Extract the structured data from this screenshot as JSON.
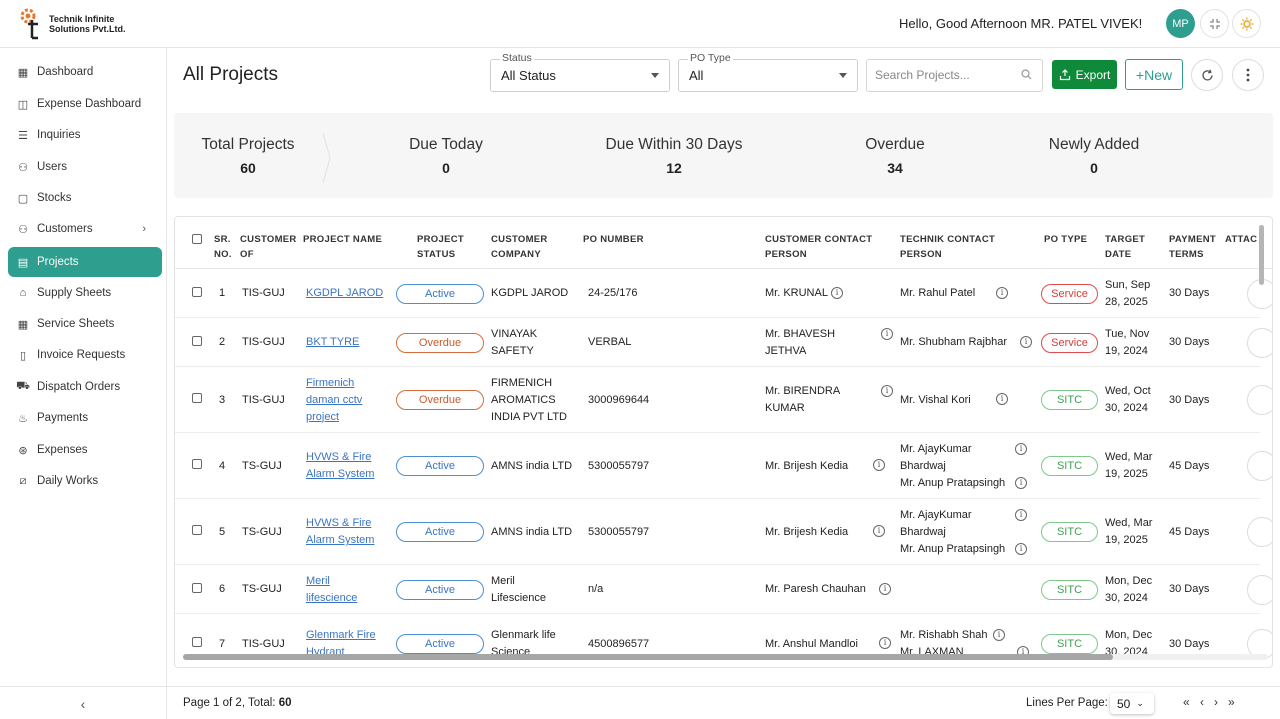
{
  "brand": {
    "logo_line1": "Technik Infinite",
    "logo_line2": "Solutions Pvt.Ltd."
  },
  "header": {
    "greeting": "Hello, Good Afternoon MR. PATEL VIVEK!",
    "avatar_initials": "MP",
    "icons": [
      "fullscreen-exit-icon",
      "theme-sun-icon"
    ]
  },
  "sidebar": {
    "items": [
      {
        "label": "Dashboard",
        "icon": "dashboard-icon"
      },
      {
        "label": "Expense Dashboard",
        "icon": "expense-dashboard-icon"
      },
      {
        "label": "Inquiries",
        "icon": "inquiries-icon"
      },
      {
        "label": "Users",
        "icon": "users-icon"
      },
      {
        "label": "Stocks",
        "icon": "stocks-icon"
      },
      {
        "label": "Customers",
        "icon": "customers-icon"
      },
      {
        "label": "Projects",
        "icon": "projects-icon"
      },
      {
        "label": "Supply Sheets",
        "icon": "supply-sheets-icon"
      },
      {
        "label": "Service Sheets",
        "icon": "service-sheets-icon"
      },
      {
        "label": "Invoice Requests",
        "icon": "invoice-icon"
      },
      {
        "label": "Dispatch Orders",
        "icon": "truck-icon"
      },
      {
        "label": "Payments",
        "icon": "payments-icon"
      },
      {
        "label": "Expenses",
        "icon": "expenses-icon"
      },
      {
        "label": "Daily Works",
        "icon": "daily-works-icon"
      }
    ],
    "active": "Projects"
  },
  "main": {
    "title": "All Projects",
    "status_filter": {
      "label": "Status",
      "value": "All Status"
    },
    "po_type_filter": {
      "label": "PO Type",
      "value": "All"
    },
    "search_placeholder": "Search Projects...",
    "export_label": "Export",
    "new_label": "+New"
  },
  "stats": [
    {
      "label": "Total Projects",
      "value": "60"
    },
    {
      "label": "Due Today",
      "value": "0"
    },
    {
      "label": "Due Within 30 Days",
      "value": "12"
    },
    {
      "label": "Overdue",
      "value": "34"
    },
    {
      "label": "Newly Added",
      "value": "0"
    }
  ],
  "table": {
    "headers": {
      "sr": [
        "SR.",
        "NO."
      ],
      "customer_of": [
        "CUSTOMER",
        "OF"
      ],
      "project_name": [
        "PROJECT NAME"
      ],
      "project_status": [
        "PROJECT",
        "STATUS"
      ],
      "customer_company": [
        "CUSTOMER",
        "COMPANY"
      ],
      "po_number": [
        "PO NUMBER"
      ],
      "customer_contact": [
        "CUSTOMER CONTACT",
        "PERSON"
      ],
      "technik_contact": [
        "TECHNIK CONTACT",
        "PERSON"
      ],
      "po_type": [
        "PO TYPE"
      ],
      "target_date": [
        "TARGET",
        "DATE"
      ],
      "payment_terms": [
        "PAYMENT",
        "TERMS"
      ],
      "attachments": [
        "ATTAC"
      ]
    },
    "rows": [
      {
        "sr": "1",
        "customer_of": "TIS-GUJ",
        "project": [
          "KGDPL JAROD"
        ],
        "status": "Active",
        "company": [
          "KGDPL JAROD"
        ],
        "po": "24-25/176",
        "contact": [
          "Mr. KRUNAL"
        ],
        "technik": [
          "Mr. Rahul Patel"
        ],
        "po_type": "Service",
        "date": [
          "Sun, Sep",
          "28, 2025"
        ],
        "terms": "30 Days"
      },
      {
        "sr": "2",
        "customer_of": "TIS-GUJ",
        "project": [
          "BKT TYRE"
        ],
        "status": "Overdue",
        "company": [
          "VINAYAK",
          "SAFETY"
        ],
        "po": "VERBAL",
        "contact": [
          "Mr. BHAVESH",
          "JETHVA"
        ],
        "technik": [
          "Mr. Shubham Rajbhar"
        ],
        "po_type": "Service",
        "date": [
          "Tue, Nov",
          "19, 2024"
        ],
        "terms": "30 Days"
      },
      {
        "sr": "3",
        "customer_of": "TIS-GUJ",
        "project": [
          "Firmenich",
          "daman cctv",
          "project"
        ],
        "status": "Overdue",
        "company": [
          "FIRMENICH",
          "AROMATICS",
          "INDIA PVT LTD"
        ],
        "po": "3000969644",
        "contact": [
          "Mr. BIRENDRA",
          "KUMAR"
        ],
        "technik": [
          "Mr. Vishal Kori"
        ],
        "po_type": "SITC",
        "date": [
          "Wed, Oct",
          "30, 2024"
        ],
        "terms": "30 Days"
      },
      {
        "sr": "4",
        "customer_of": "TS-GUJ",
        "project": [
          "HVWS & Fire",
          "Alarm System"
        ],
        "status": "Active",
        "company": [
          "AMNS india LTD"
        ],
        "po": "5300055797",
        "contact": [
          "Mr. Brijesh Kedia"
        ],
        "technik": [
          "Mr. AjayKumar",
          "Bhardwaj",
          "Mr. Anup Pratapsingh"
        ],
        "po_type": "SITC",
        "date": [
          "Wed, Mar",
          "19, 2025"
        ],
        "terms": "45 Days"
      },
      {
        "sr": "5",
        "customer_of": "TS-GUJ",
        "project": [
          "HVWS & Fire",
          "Alarm System"
        ],
        "status": "Active",
        "company": [
          "AMNS india LTD"
        ],
        "po": "5300055797",
        "contact": [
          "Mr. Brijesh Kedia"
        ],
        "technik": [
          "Mr. AjayKumar",
          "Bhardwaj",
          "Mr. Anup Pratapsingh"
        ],
        "po_type": "SITC",
        "date": [
          "Wed, Mar",
          "19, 2025"
        ],
        "terms": "45 Days"
      },
      {
        "sr": "6",
        "customer_of": "TS-GUJ",
        "project": [
          "Meril",
          "lifescience"
        ],
        "status": "Active",
        "company": [
          "Meril",
          "Lifescience"
        ],
        "po": "n/a",
        "contact": [
          "Mr. Paresh Chauhan"
        ],
        "technik": [],
        "po_type": "SITC",
        "date": [
          "Mon, Dec",
          "30, 2024"
        ],
        "terms": "30 Days"
      },
      {
        "sr": "7",
        "customer_of": "TIS-GUJ",
        "project": [
          "Glenmark Fire",
          "Hydrant"
        ],
        "status": "Active",
        "company": [
          "Glenmark life",
          "Science"
        ],
        "po": "4500896577",
        "contact": [
          "Mr. Anshul Mandloi"
        ],
        "technik": [
          "Mr. Rishabh Shah",
          "Mr. LAXMAN"
        ],
        "po_type": "SITC",
        "date": [
          "Mon, Dec",
          "30, 2024"
        ],
        "terms": "30 Days"
      }
    ]
  },
  "footer": {
    "page_prefix": "Page 1 of 2, Total: ",
    "total": "60",
    "lines_per_page_label": "Lines Per Page:",
    "lines_per_page_value": "50"
  },
  "colors": {
    "accent": "#2e9e8f",
    "export": "#0e8a3a",
    "active": "#3a74c4",
    "overdue": "#c85a2a",
    "service": "#d43c3c",
    "sitc": "#3e9e55"
  }
}
